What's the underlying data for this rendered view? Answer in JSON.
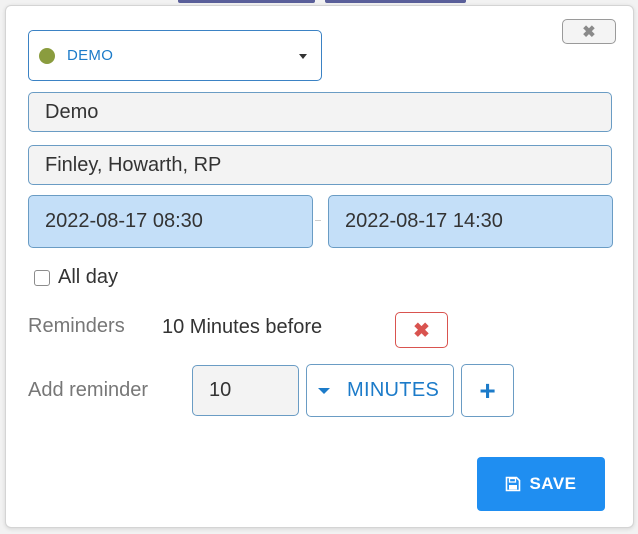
{
  "dialog": {
    "close_glyph": "✖",
    "calendar": {
      "selected": "DEMO",
      "color": "#8a9c3e"
    },
    "title_value": "Demo",
    "attendees_value": "Finley, Howarth, RP",
    "start_value": "2022-08-17 08:30",
    "end_value": "2022-08-17 14:30",
    "all_day_label": "All day",
    "reminders_label": "Reminders",
    "reminder_item": "10 Minutes before",
    "remove_glyph": "✖",
    "add_reminder_label": "Add reminder",
    "reminder_amount": "10",
    "reminder_unit": "MINUTES",
    "add_glyph": "+",
    "save_label": "SAVE",
    "colors": {
      "accent": "#1f8ef1",
      "danger": "#d9534f",
      "date_bg": "#c4dff8"
    }
  }
}
